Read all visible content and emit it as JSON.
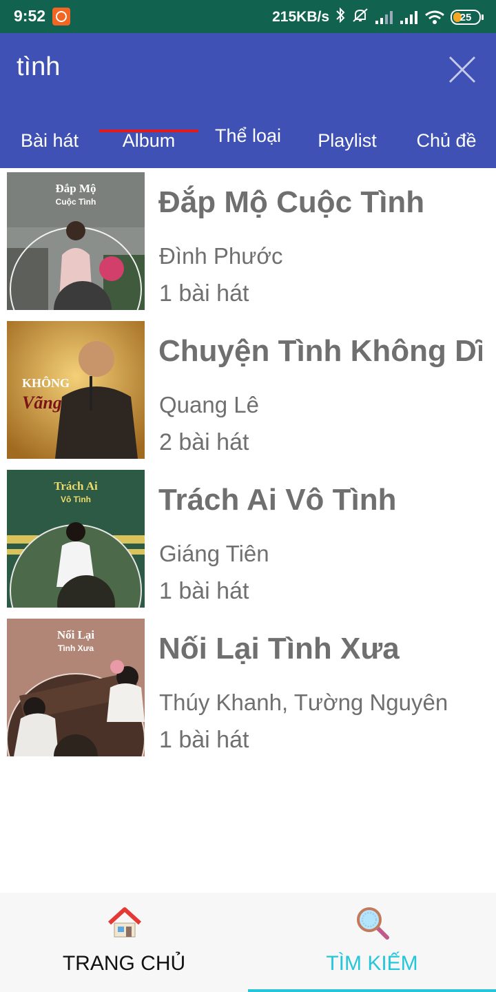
{
  "status_bar": {
    "time": "9:52",
    "network_speed": "215KB/s",
    "battery_level": "25",
    "icons": [
      "app-notification-icon",
      "bluetooth-icon",
      "alarm-off-icon",
      "signal-icon",
      "signal-icon",
      "wifi-icon",
      "battery-icon"
    ]
  },
  "search": {
    "query": "tình",
    "close_icon": "close-icon"
  },
  "tabs": [
    {
      "label": "Bài hát",
      "selected": false
    },
    {
      "label": "Album",
      "selected": true
    },
    {
      "label": "Thể loại",
      "selected": false
    },
    {
      "label": "Playlist",
      "selected": false
    },
    {
      "label": "Chủ đề",
      "selected": false
    }
  ],
  "albums": [
    {
      "name": "Đắp Mộ Cuộc Tình",
      "artist": "Đình Phước",
      "count": "1 bài hát",
      "cover_title": "Đắp Mộ",
      "cover_subtitle": "Cuộc Tình"
    },
    {
      "name": "Chuyện Tình Không Dĩ Vãng",
      "artist": "Quang Lê",
      "count": "2 bài hát",
      "cover_title": "KHÔNG",
      "cover_subtitle": "Vãng"
    },
    {
      "name": "Trách Ai Vô Tình",
      "artist": "Giáng Tiên",
      "count": "1 bài hát",
      "cover_title": "Trách Ai",
      "cover_subtitle": "Vô Tình"
    },
    {
      "name": "Nối Lại Tình Xưa",
      "artist": "Thúy Khanh, Tường Nguyên",
      "count": "1 bài hát",
      "cover_title": "Nối Lại",
      "cover_subtitle": "Tình Xưa"
    }
  ],
  "bottom_nav": [
    {
      "label": "TRANG CHỦ",
      "icon": "home-icon",
      "selected": false
    },
    {
      "label": "TÌM KIẾM",
      "icon": "magnifier-icon",
      "selected": true
    }
  ],
  "colors": {
    "status_bar": "#11634f",
    "app_bar": "#3f51b5",
    "tab_indicator": "#e21a1a",
    "active_nav": "#26c6da",
    "text_gray": "#6f6f6f"
  }
}
